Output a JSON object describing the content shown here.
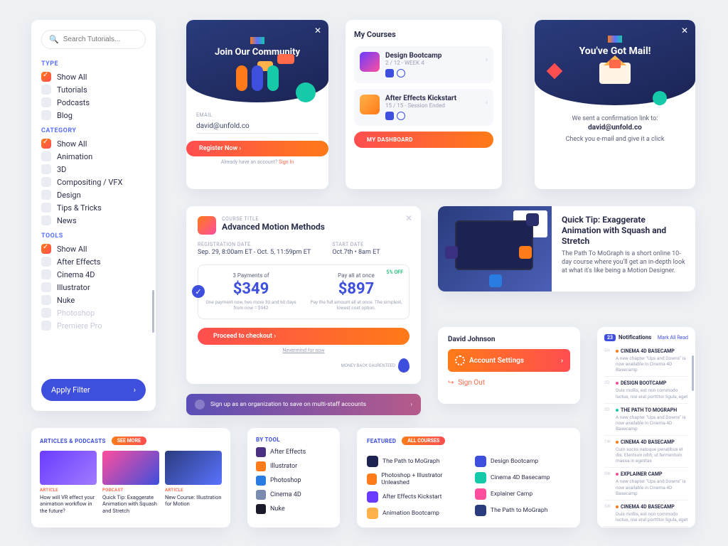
{
  "sidebar": {
    "search_placeholder": "Search Tutorials...",
    "type_label": "TYPE",
    "type_items": [
      "Show All",
      "Tutorials",
      "Podcasts",
      "Blog"
    ],
    "category_label": "CATEGORY",
    "category_items": [
      "Show All",
      "Animation",
      "3D",
      "Compositing / VFX",
      "Design",
      "Tips & Tricks",
      "News"
    ],
    "tools_label": "TOOLS",
    "tools_items": [
      "Show All",
      "After Effects",
      "Cinema 4D",
      "Illustrator",
      "Nuke",
      "Photoshop",
      "Premiere Pro"
    ],
    "apply_label": "Apply Filter"
  },
  "community": {
    "title": "Join Our Community",
    "email_label": "EMAIL",
    "email_value": "david@unfold.co",
    "register_label": "Register Now",
    "already_text": "Already have an account?",
    "signin_text": "Sign In"
  },
  "mycourses": {
    "title": "My Courses",
    "items": [
      {
        "title": "Design Bootcamp",
        "sub": "2 / 12 - WEEK 4"
      },
      {
        "title": "After Effects Kickstart",
        "sub": "15 / 15 - Session Ended"
      }
    ],
    "dashboard_label": "MY DASHBOARD"
  },
  "mail": {
    "title": "You've Got Mail!",
    "line1": "We sent a confirmation link to:",
    "email": "david@unfold.co",
    "line2": "Check you e-mail and give it a click"
  },
  "pricing": {
    "eyebrow": "COURSE TITLE",
    "title": "Advanced Motion Methods",
    "reg_label": "REGISTRATION DATE",
    "reg_value": "Sep. 29, 8:00am ET - Oct. 5, 11:59pm ET",
    "start_label": "START DATE",
    "start_value": "Oct.7th • 8am ET",
    "plan_a_top": "3 Payments of",
    "plan_a_price": "$349",
    "plan_a_sub": "One payment now, two more 30 and 60 days from now = $942",
    "plan_b_top": "Pay all at once",
    "plan_b_price": "$897",
    "plan_b_sub": "Pay the full amount all at once. The simplest, lowest cost option.",
    "off": "5% OFF",
    "proceed": "Proceed to checkout",
    "nevermind": "Nevermind for now",
    "guarantee": "MONEY BACK GAURENTEED"
  },
  "quicktip": {
    "title": "Quick Tip: Exaggerate Animation with Squash and Stretch",
    "body": "The Path To MoGraph is a short online 10-day course where you'll get an in-depth look at what it's like being a Motion Designer."
  },
  "account": {
    "name": "David Johnson",
    "settings": "Account Settings",
    "signout": "Sign Out"
  },
  "orgbanner": {
    "text": "Sign up as an organization to save on multi-staff accounts"
  },
  "articles": {
    "heading": "ARTICLES & PODCASTS",
    "seemore": "SEE MORE",
    "items": [
      {
        "tag": "ARTICLE",
        "title": "How will VR effect your animation workflow in the future?"
      },
      {
        "tag": "PODCAST",
        "title": "Quick Tip: Exaggerate Animation with Squash and Stretch"
      },
      {
        "tag": "ARTICLE",
        "title": "New Course: Illustration for Motion"
      }
    ]
  },
  "bytool": {
    "heading": "BY TOOL",
    "items": [
      "After Effects",
      "Illustrator",
      "Photoshop",
      "Cinema 4D",
      "Nuke"
    ]
  },
  "featured": {
    "heading": "FEATURED",
    "all": "ALL COURSES",
    "left": [
      "The Path to MoGraph",
      "Photoshop + Illustrator Unleashed",
      "After Effects Kickstart",
      "Animation Bootcamp"
    ],
    "right": [
      "Design Bootcamp",
      "Cinema 4D Basecamp",
      "Explainer Camp",
      "The Path to MoGraph"
    ]
  },
  "notif": {
    "count": "23",
    "heading": "Notifications",
    "mark": "Mark All Read",
    "items": [
      {
        "time": "5H",
        "dot": "do",
        "title": "CINEMA 4D BASECAMP",
        "desc": "A new chapter \"Ups and Downs\" is now available in Cinema 4D Basecamp"
      },
      {
        "time": "2D",
        "dot": "dp",
        "title": "DESIGN BOOTCAMP",
        "desc": "Duis mollis, est non commodo luctus, nisi erat porttitor ligula, eget"
      },
      {
        "time": "5D",
        "dot": "dg",
        "title": "THE PATH TO MOGRAPH",
        "desc": "A new chapter \"Ups and Downs\" is now available in Cinema 4D Basecamp"
      },
      {
        "time": "1W",
        "dot": "do",
        "title": "CINEMA 4D BASECAMP",
        "desc": "Cum sociis natoque penatibus et dis. Elentium nibh, ut fermentum massa in egestas"
      },
      {
        "time": "3W",
        "dot": "dp",
        "title": "EXPLAINER CAMP",
        "desc": "A new chapter \"Ups and Downs\" is now available in Cinema 4D Basecamp"
      },
      {
        "time": "5W",
        "dot": "do",
        "title": "CINEMA 4D BASECAMP",
        "desc": "Duis mollis, est non commodo luctus, nisi erat porttitor ligula, eget"
      }
    ]
  }
}
